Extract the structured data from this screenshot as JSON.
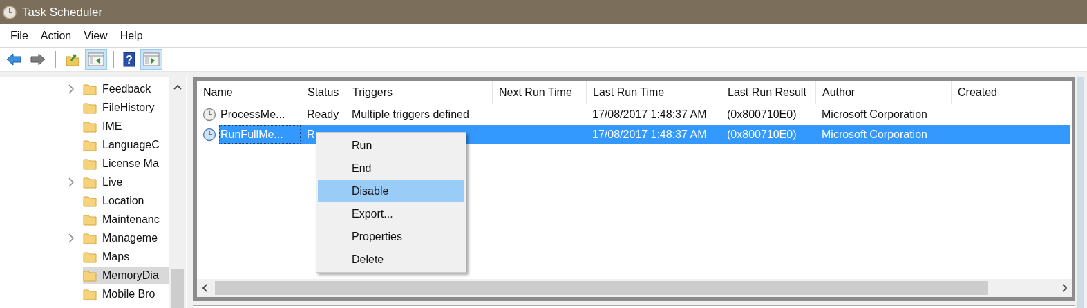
{
  "window": {
    "title": "Task Scheduler"
  },
  "menu_bar": [
    "File",
    "Action",
    "View",
    "Help"
  ],
  "toolbar": [
    {
      "kind": "back",
      "disabled": false
    },
    {
      "kind": "forward",
      "disabled": true
    },
    {
      "kind": "separator"
    },
    {
      "kind": "up",
      "on": false
    },
    {
      "kind": "console-tree",
      "on": true
    },
    {
      "kind": "separator"
    },
    {
      "kind": "help",
      "on": false,
      "glyph": "?"
    },
    {
      "kind": "action-pane",
      "on": true
    }
  ],
  "tree": {
    "items": [
      {
        "label": "Feedback",
        "expandable": true,
        "selected": false
      },
      {
        "label": "FileHistory",
        "expandable": false,
        "selected": false
      },
      {
        "label": "IME",
        "expandable": false,
        "selected": false
      },
      {
        "label": "LanguageC",
        "expandable": false,
        "selected": false
      },
      {
        "label": "License Ma",
        "expandable": false,
        "selected": false
      },
      {
        "label": "Live",
        "expandable": true,
        "selected": false
      },
      {
        "label": "Location",
        "expandable": false,
        "selected": false
      },
      {
        "label": "Maintenanc",
        "expandable": false,
        "selected": false
      },
      {
        "label": "Manageme",
        "expandable": true,
        "selected": false
      },
      {
        "label": "Maps",
        "expandable": false,
        "selected": false
      },
      {
        "label": "MemoryDia",
        "expandable": false,
        "selected": true
      },
      {
        "label": "Mobile Bro",
        "expandable": false,
        "selected": false
      }
    ]
  },
  "table": {
    "columns": [
      "Name",
      "Status",
      "Triggers",
      "Next Run Time",
      "Last Run Time",
      "Last Run Result",
      "Author",
      "Created"
    ],
    "rows": [
      {
        "name": "ProcessMe...",
        "status": "Ready",
        "triggers": "Multiple triggers defined",
        "last_run_time": "17/08/2017 1:48:37 AM",
        "last_run_result": "(0x800710E0)",
        "author": "Microsoft Corporation",
        "selected": false
      },
      {
        "name": "RunFullMe...",
        "status": "R",
        "last_run_time": "17/08/2017 1:48:37 AM",
        "last_run_result": "(0x800710E0)",
        "author": "Microsoft Corporation",
        "selected": true
      }
    ]
  },
  "context_menu": {
    "items": [
      {
        "label": "Run",
        "selected": false
      },
      {
        "label": "End",
        "selected": false
      },
      {
        "label": "Disable",
        "selected": true
      },
      {
        "label": "Export...",
        "selected": false
      },
      {
        "label": "Properties",
        "selected": false
      },
      {
        "label": "Delete",
        "selected": false
      }
    ]
  }
}
